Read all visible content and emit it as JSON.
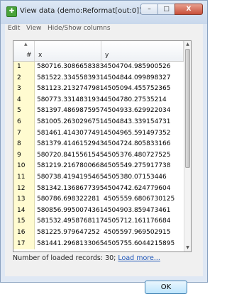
{
  "window": {
    "title": "View data (demo:Reformat[out:0])",
    "min_glyph": "–",
    "max_glyph": "□",
    "close_glyph": "X"
  },
  "menu": {
    "edit": "Edit",
    "view": "View",
    "hide_show": "Hide/Show columns"
  },
  "table": {
    "headers": {
      "index": "#",
      "x": "x",
      "y": "y"
    },
    "rows": [
      {
        "n": "1",
        "x": "580716.3086658383",
        "y": "4504704.985900526"
      },
      {
        "n": "2",
        "x": "581522.3345583931",
        "y": "4504844.099898327"
      },
      {
        "n": "3",
        "x": "581123.2132747981",
        "y": "4505094.455752365"
      },
      {
        "n": "4",
        "x": "580773.3314831934",
        "y": "4504780.27535214"
      },
      {
        "n": "5",
        "x": "581397.4869875957",
        "y": "4504933.629922034"
      },
      {
        "n": "6",
        "x": "581005.2630296751",
        "y": "4504843.339154731"
      },
      {
        "n": "7",
        "x": "581461.4143077491",
        "y": "4504965.591497352"
      },
      {
        "n": "8",
        "x": "581379.4146152943",
        "y": "4504724.805833166"
      },
      {
        "n": "9",
        "x": "580720.8415561545",
        "y": "4505376.480727525"
      },
      {
        "n": "10",
        "x": "581219.2167800668",
        "y": "4505549.275917738"
      },
      {
        "n": "11",
        "x": "580738.4194195465",
        "y": "4505380.07153446"
      },
      {
        "n": "12",
        "x": "581342.1368677395",
        "y": "4504742.624779604"
      },
      {
        "n": "13",
        "x": "580786.698322281",
        "y": "4505559.6806730125"
      },
      {
        "n": "14",
        "x": "580856.9950074361",
        "y": "4504903.859473461"
      },
      {
        "n": "15",
        "x": "581532.4958768117",
        "y": "4505712.161176684"
      },
      {
        "n": "16",
        "x": "581225.979647252",
        "y": "4505597.969502915"
      },
      {
        "n": "17",
        "x": "581441.2968133065",
        "y": "4505755.6044215895"
      }
    ]
  },
  "status": {
    "text": "Number of loaded records: 30;",
    "load_more": "Load more..."
  },
  "buttons": {
    "ok": "OK"
  }
}
